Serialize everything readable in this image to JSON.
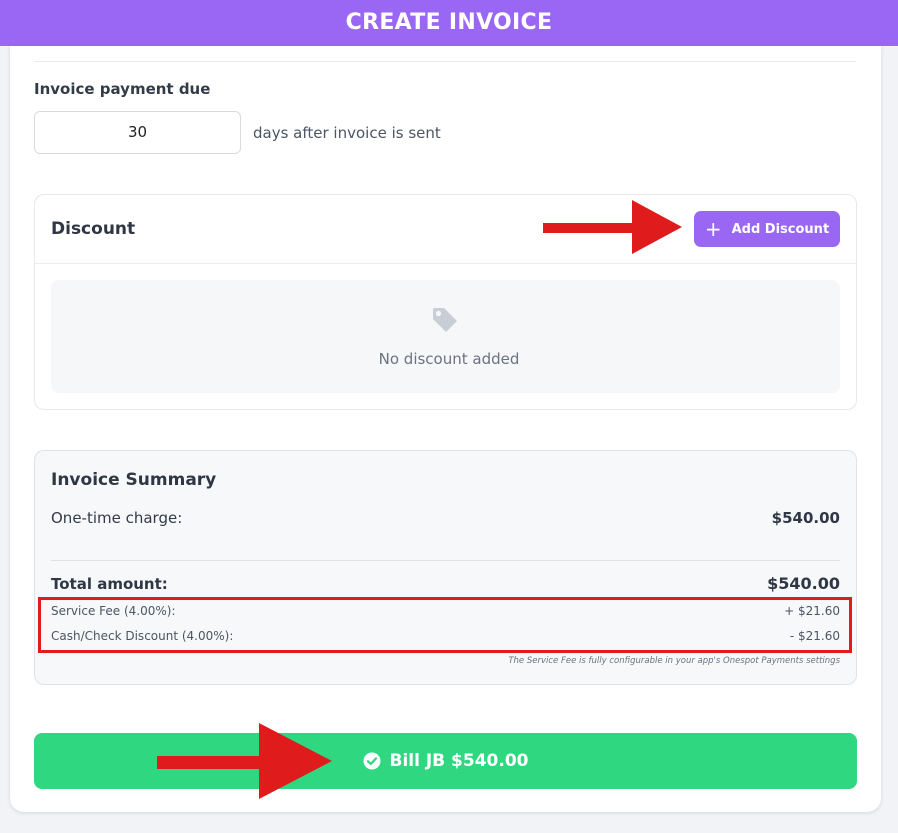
{
  "header": {
    "title": "CREATE INVOICE"
  },
  "payment_due": {
    "label": "Invoice payment due",
    "value": "30",
    "suffix": "days after invoice is sent"
  },
  "discount": {
    "title": "Discount",
    "add_button_label": "Add Discount",
    "empty_text": "No discount added",
    "empty_icon": "tag-icon"
  },
  "summary": {
    "title": "Invoice Summary",
    "one_time_label": "One-time charge:",
    "one_time_value": "$540.00",
    "total_label": "Total amount:",
    "total_value": "$540.00",
    "service_fee_label": "Service Fee (4.00%):",
    "service_fee_value": "+ $21.60",
    "cash_discount_label": "Cash/Check Discount (4.00%):",
    "cash_discount_value": "- $21.60",
    "note": "The Service Fee is fully configurable in your app's Onespot Payments settings"
  },
  "bill_button": {
    "label": "Bill JB $540.00",
    "icon": "check-circle-icon"
  },
  "colors": {
    "accent": "#9a67f4",
    "success": "#2fd880",
    "annotation_red": "#e01b1b"
  }
}
